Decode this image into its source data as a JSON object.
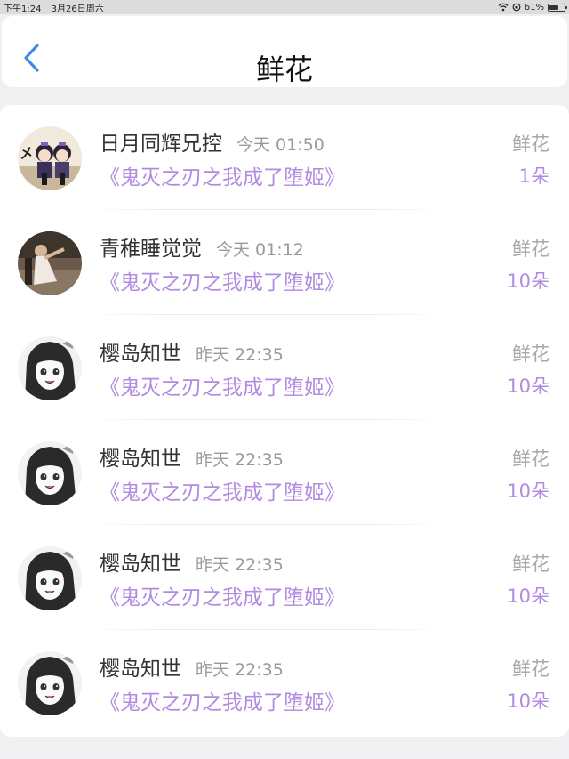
{
  "status_bar": {
    "time": "下午1:24",
    "date": "3月26日周六",
    "battery": "61%",
    "battery_level": 0.61
  },
  "header": {
    "title": "鲜花",
    "back_icon": "chevron-left-icon",
    "accent_color": "#3a8ee6"
  },
  "records": [
    {
      "user": "日月同辉兄控",
      "time": "今天 01:50",
      "book": "《鬼灭之刃之我成了堕姬》",
      "gift": "鲜花",
      "count": "1朵",
      "avatar": "avatar-anime-pair"
    },
    {
      "user": "青稚睡觉觉",
      "time": "今天 01:12",
      "book": "《鬼灭之刃之我成了堕姬》",
      "gift": "鲜花",
      "count": "10朵",
      "avatar": "avatar-photo-dancer"
    },
    {
      "user": "樱岛知世",
      "time": "昨天 22:35",
      "book": "《鬼灭之刃之我成了堕姬》",
      "gift": "鲜花",
      "count": "10朵",
      "avatar": "avatar-anime-girl"
    },
    {
      "user": "樱岛知世",
      "time": "昨天 22:35",
      "book": "《鬼灭之刃之我成了堕姬》",
      "gift": "鲜花",
      "count": "10朵",
      "avatar": "avatar-anime-girl"
    },
    {
      "user": "樱岛知世",
      "time": "昨天 22:35",
      "book": "《鬼灭之刃之我成了堕姬》",
      "gift": "鲜花",
      "count": "10朵",
      "avatar": "avatar-anime-girl"
    },
    {
      "user": "樱岛知世",
      "time": "昨天 22:35",
      "book": "《鬼灭之刃之我成了堕姬》",
      "gift": "鲜花",
      "count": "10朵",
      "avatar": "avatar-anime-girl"
    }
  ],
  "colors": {
    "book_link": "#b08be0",
    "muted": "#9a9a9a"
  }
}
